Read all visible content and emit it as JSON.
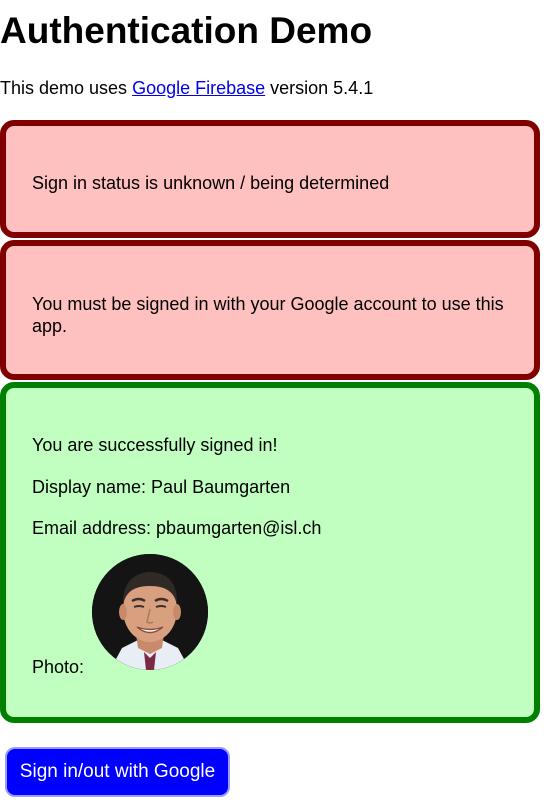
{
  "page": {
    "title": "Authentication Demo"
  },
  "intro": {
    "prefix": "This demo uses ",
    "link_text": "Google Firebase",
    "suffix": " version 5.4.1"
  },
  "status_unknown": {
    "message": "Sign in status is unknown / being determined"
  },
  "signed_out": {
    "message": "You must be signed in with your Google account to use this app."
  },
  "signed_in": {
    "message": "You are successfully signed in!",
    "display_name_line": "Display name: Paul Baumgarten",
    "email_line": "Email address: pbaumgarten@isl.ch",
    "photo_label": "Photo:"
  },
  "actions": {
    "signin_button_label": "Sign in/out with Google"
  },
  "colors": {
    "error_background": "#ffc0c0",
    "error_border": "#800000",
    "success_background": "#c0ffc0",
    "success_border": "#008000",
    "button_background": "#0000ff",
    "link": "#0000ee"
  }
}
